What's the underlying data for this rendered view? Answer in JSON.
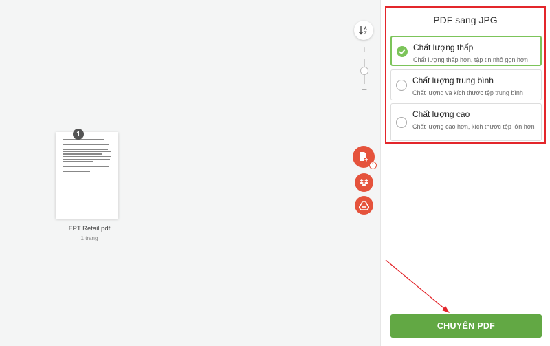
{
  "workspace": {
    "file": {
      "name": "FPT Retail.pdf",
      "pages_label": "1 trang",
      "page_count_badge": "1"
    },
    "add_count_badge": "1",
    "zoom_plus": "+",
    "zoom_minus": "−",
    "icons": [
      "sort-az-icon",
      "add-file-icon",
      "dropbox-icon",
      "google-drive-icon"
    ]
  },
  "panel": {
    "title": "PDF sang JPG",
    "options": [
      {
        "title": "Chất lượng thấp",
        "desc": "Chất lượng thấp hơn, tập tin nhỏ gọn hơn",
        "selected": true
      },
      {
        "title": "Chất lượng trung bình",
        "desc": "Chất lượng và kích thước tệp trung bình",
        "selected": false
      },
      {
        "title": "Chất lượng cao",
        "desc": "Chất lượng cao hơn, kích thước tệp lớn hơn",
        "selected": false
      }
    ],
    "convert_label": "CHUYỂN PDF"
  },
  "colors": {
    "accent_green": "#62a844",
    "selected_border": "#7cc45a",
    "highlight_red": "#e3262b",
    "action_orange": "#e5533c"
  }
}
